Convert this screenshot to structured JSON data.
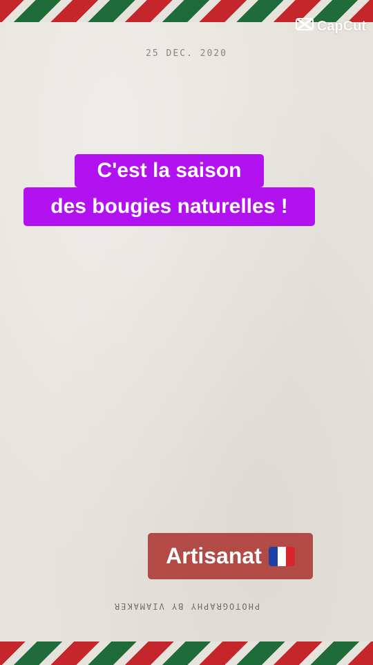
{
  "watermark": {
    "text": "CapCut",
    "icon": "capcut-logo-icon"
  },
  "card": {
    "date": "25 DEC. 2020",
    "credit": "PHOTOGRAPHY BY VIAMAKER"
  },
  "caption": {
    "line1": "C'est la saison",
    "line2": "des bougies naturelles !",
    "background": "#b312f0"
  },
  "tag": {
    "label": "Artisanat",
    "icon": "france-flag-icon",
    "background": "#b24a45"
  },
  "colors": {
    "stripe_red": "#c4262b",
    "stripe_green": "#1f6b3a",
    "paper": "#e6e3dd"
  }
}
